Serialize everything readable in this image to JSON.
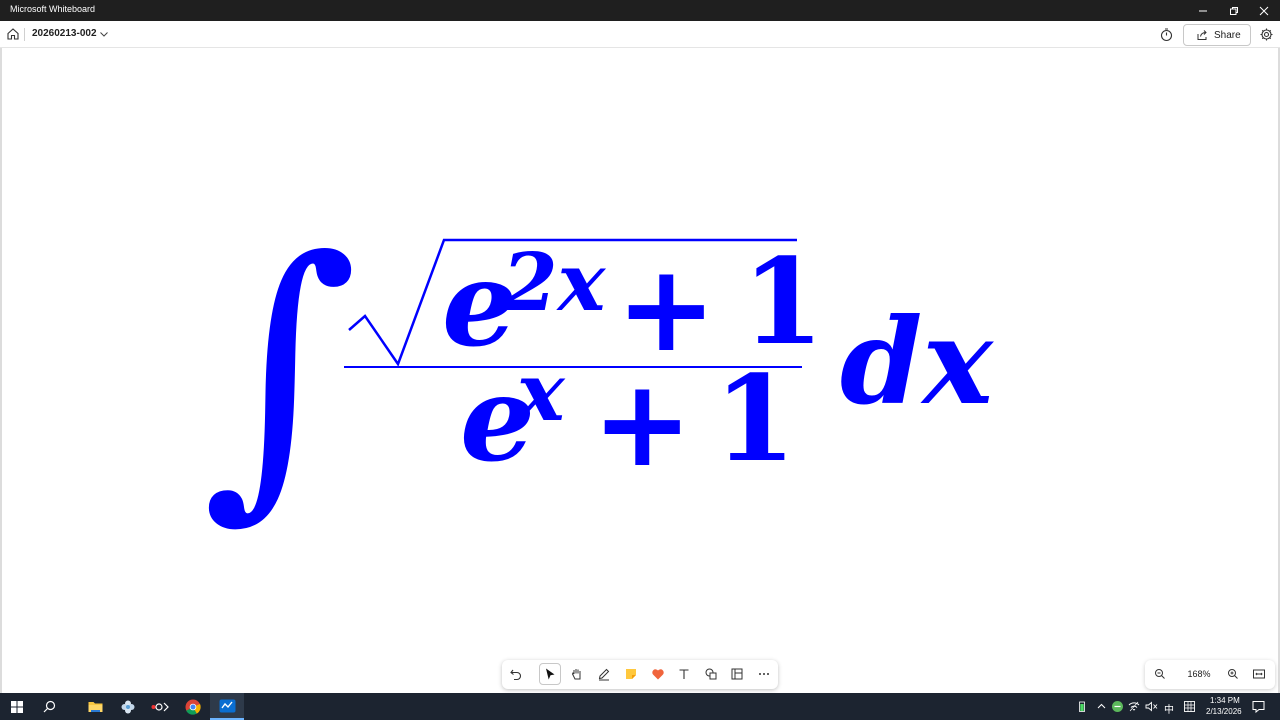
{
  "window": {
    "title": "Microsoft Whiteboard"
  },
  "appbar": {
    "board_name": "20260213-002",
    "share_label": "Share"
  },
  "canvas": {
    "formula_color": "#0000ff",
    "formula": {
      "integral": "∫",
      "num_base": "e",
      "num_exp": "2x",
      "num_plus": "+",
      "num_one": "1",
      "den_base": "e",
      "den_exp": "x",
      "den_plus": "+",
      "den_one": "1",
      "differential": "dx"
    }
  },
  "toolbar": {
    "tools": [
      "undo-icon",
      "select-icon",
      "pan-hand-icon",
      "pen-icon",
      "sticky-note-icon",
      "reaction-heart-icon",
      "text-icon",
      "shapes-icon",
      "template-icon",
      "more-icon"
    ],
    "active_tool": "select-icon"
  },
  "zoom": {
    "level": "168%"
  },
  "taskbar": {
    "time": "1:34 PM",
    "date": "2/13/2026",
    "ime": "中"
  }
}
